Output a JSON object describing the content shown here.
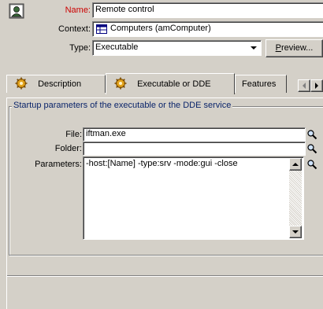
{
  "form": {
    "name_label": "Name:",
    "name_value": "Remote control",
    "context_label": "Context:",
    "context_value": "Computers (amComputer)",
    "type_label": "Type:",
    "type_value": "Executable",
    "preview_first": "P",
    "preview_rest": "review..."
  },
  "tabs": [
    {
      "label": "Description"
    },
    {
      "label": "Executable or DDE"
    },
    {
      "label": "Features"
    }
  ],
  "group": {
    "title": "Startup parameters of the executable or the DDE service",
    "file_label": "File:",
    "file_value": "iftman.exe",
    "folder_label": "Folder:",
    "folder_value": "",
    "parameters_label": "Parameters:",
    "parameters_value": "-host:[Name] -type:srv -mode:gui -close"
  },
  "colors": {
    "name_label": "#cc0000",
    "accent": "#0a246a"
  },
  "icons": {
    "record": "user-icon",
    "context": "table-icon",
    "tab_description": "gear-icon",
    "tab_exec": "gear-icon",
    "lookup": "magnifier-icon"
  }
}
